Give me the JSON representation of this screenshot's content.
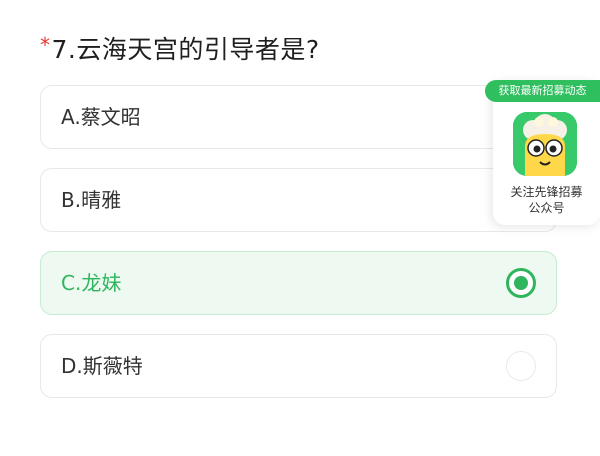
{
  "question": {
    "required_mark": "*",
    "title": "7.云海天宫的引导者是?"
  },
  "options": [
    {
      "label": "A.蔡文昭",
      "selected": false
    },
    {
      "label": "B.晴雅",
      "selected": false
    },
    {
      "label": "C.龙妹",
      "selected": true
    },
    {
      "label": "D.斯薇特",
      "selected": false
    }
  ],
  "promo": {
    "tag": "获取最新招募动态",
    "line1": "关注先锋招募",
    "line2": "公众号",
    "logo_icon": "mascot-logo-icon"
  },
  "colors": {
    "accent": "#2fb55e",
    "selected_bg": "#eefaf1",
    "required": "#e53935",
    "promo_tag": "#2fbf5f"
  }
}
